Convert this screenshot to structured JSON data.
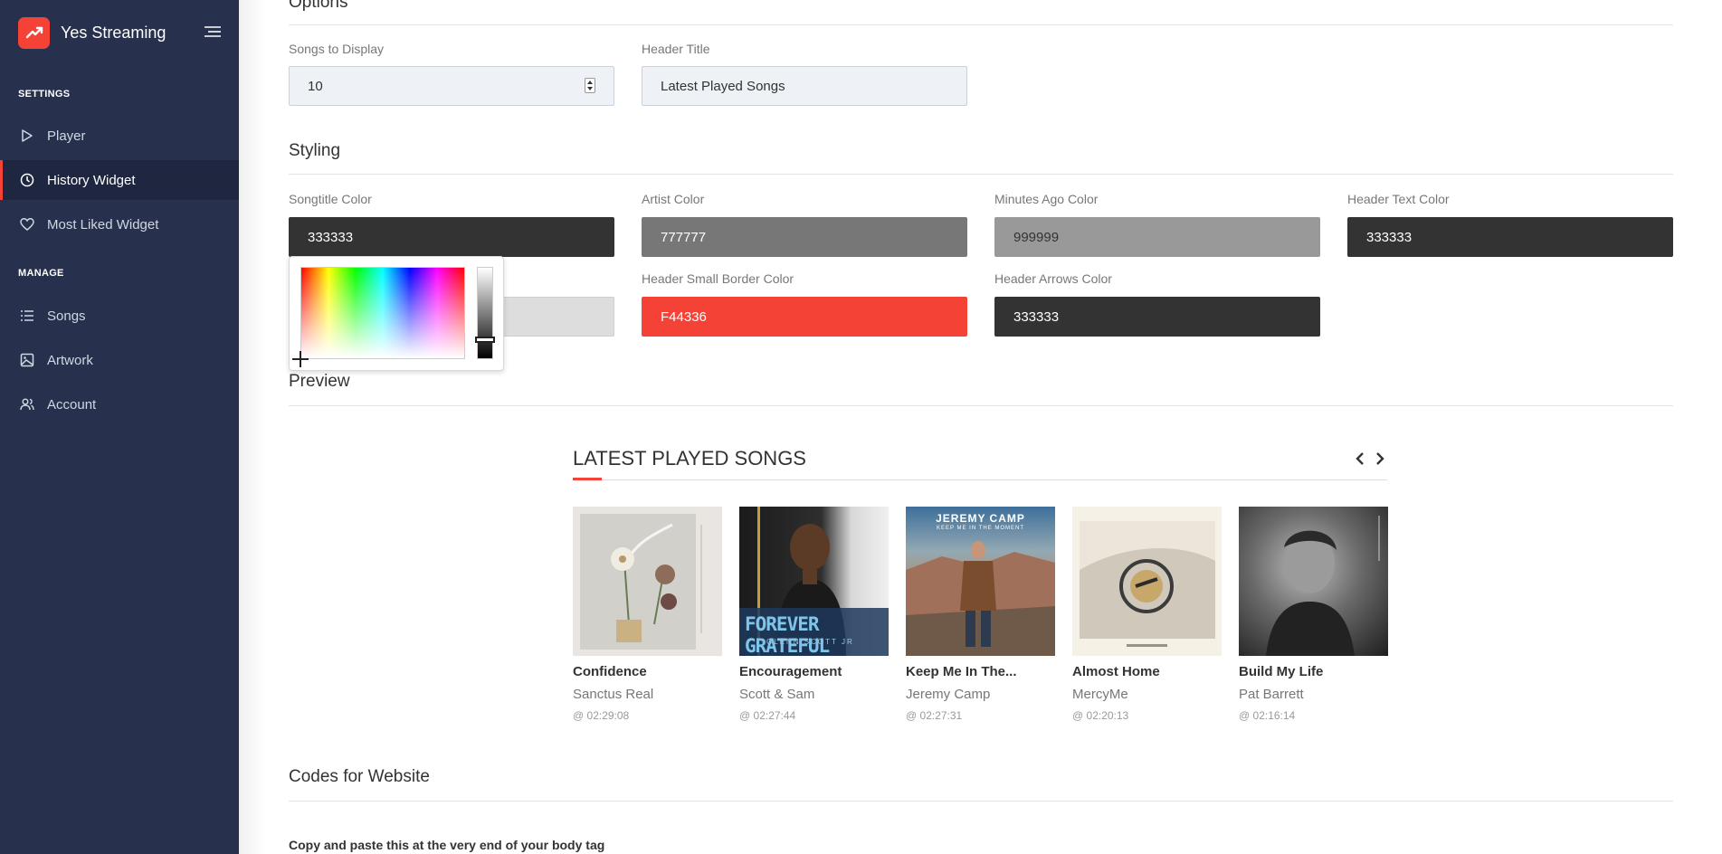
{
  "app": {
    "name": "Yes Streaming"
  },
  "sidebar": {
    "settings_label": "SETTINGS",
    "manage_label": "MANAGE",
    "items": [
      {
        "label": "Player"
      },
      {
        "label": "History Widget"
      },
      {
        "label": "Most Liked Widget"
      },
      {
        "label": "Songs"
      },
      {
        "label": "Artwork"
      },
      {
        "label": "Account"
      }
    ]
  },
  "options": {
    "title": "Options",
    "songs_to_display": {
      "label": "Songs to Display",
      "value": "10"
    },
    "header_title": {
      "label": "Header Title",
      "value": "Latest Played Songs"
    }
  },
  "styling": {
    "title": "Styling",
    "fields": [
      {
        "label": "Songtitle Color",
        "value": "333333",
        "bg": "#333333",
        "fg": "#ffffff"
      },
      {
        "label": "Artist Color",
        "value": "777777",
        "bg": "#777777",
        "fg": "#ffffff"
      },
      {
        "label": "Minutes Ago Color",
        "value": "999999",
        "bg": "#999999",
        "fg": "#333333"
      },
      {
        "label": "Header Text Color",
        "value": "333333",
        "bg": "#333333",
        "fg": "#ffffff"
      },
      {
        "label": "Header Small Border Color",
        "value": "F44336",
        "bg": "#F44336",
        "fg": "#ffffff"
      },
      {
        "label": "Header Arrows Color",
        "value": "333333",
        "bg": "#333333",
        "fg": "#ffffff"
      }
    ]
  },
  "preview": {
    "title": "Preview",
    "header": "LATEST PLAYED SONGS",
    "songs": [
      {
        "title": "Confidence",
        "artist": "Sanctus Real",
        "time": "@ 02:29:08"
      },
      {
        "title": "Encouragement",
        "artist": "Scott & Sam",
        "time": "@ 02:27:44"
      },
      {
        "title": "Keep Me In The...",
        "artist": "Jeremy Camp",
        "time": "@ 02:27:31"
      },
      {
        "title": "Almost Home",
        "artist": "MercyMe",
        "time": "@ 02:20:13"
      },
      {
        "title": "Build My Life",
        "artist": "Pat Barrett",
        "time": "@ 02:16:14"
      }
    ]
  },
  "codes": {
    "title": "Codes for Website",
    "instruction": "Copy and paste this at the very end of your body tag"
  },
  "artwork_text": {
    "encouragement": "FOREVER GRATEFUL",
    "encouragement_sub": "GLENN SCOTT JR",
    "keep_me": "JEREMY CAMP",
    "keep_me_sub": "KEEP ME IN THE MOMENT"
  },
  "colors": {
    "accent": "#f44336",
    "sidebar": "#27304d"
  }
}
